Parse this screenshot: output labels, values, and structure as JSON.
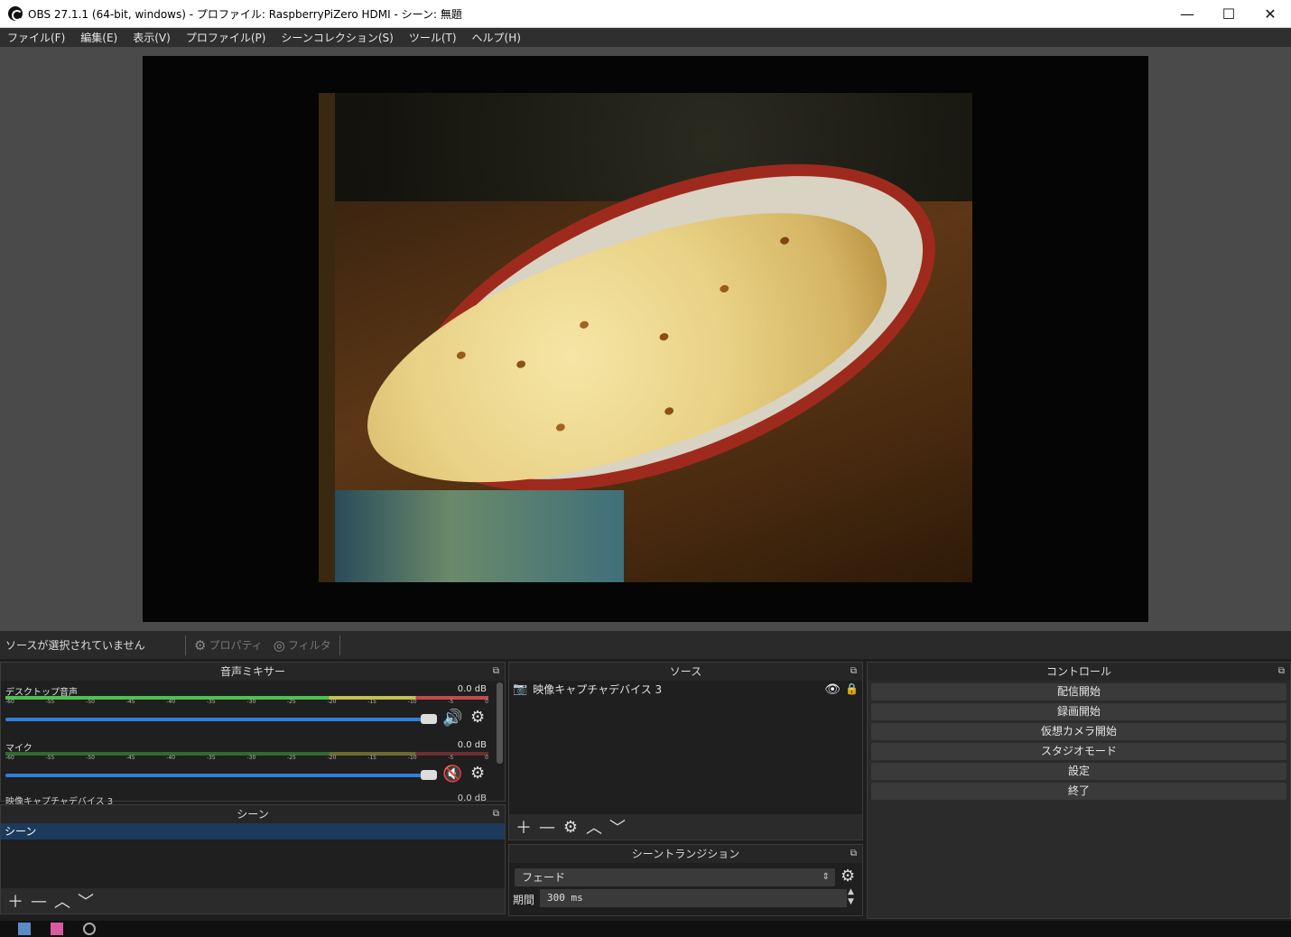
{
  "window": {
    "title": "OBS 27.1.1 (64-bit, windows) - プロファイル: RaspberryPiZero HDMI - シーン: 無題",
    "minimize": "—",
    "maximize": "☐",
    "close": "✕"
  },
  "menu": [
    "ファイル(F)",
    "編集(E)",
    "表示(V)",
    "プロファイル(P)",
    "シーンコレクション(S)",
    "ツール(T)",
    "ヘルプ(H)"
  ],
  "status": {
    "no_source": "ソースが選択されていません",
    "properties": "プロパティ",
    "filters": "フィルタ"
  },
  "mixer": {
    "title": "音声ミキサー",
    "ticks": [
      "-60",
      "-55",
      "-50",
      "-45",
      "-40",
      "-35",
      "-30",
      "-25",
      "-20",
      "-15",
      "-10",
      "-5",
      "0"
    ],
    "channels": [
      {
        "name": "デスクトップ音声",
        "db": "0.0 dB",
        "volume": 1.0,
        "muted": false
      },
      {
        "name": "マイク",
        "db": "0.0 dB",
        "volume": 1.0,
        "muted": true
      },
      {
        "name": "映像キャプチャデバイス 3",
        "db": "0.0 dB"
      }
    ]
  },
  "scenes": {
    "title": "シーン",
    "items": [
      "シーン"
    ]
  },
  "sources": {
    "title": "ソース",
    "items": [
      "映像キャプチャデバイス 3"
    ]
  },
  "transitions": {
    "title": "シーントランジション",
    "selected": "フェード",
    "duration_label": "期間",
    "duration": "300 ms"
  },
  "controls": {
    "title": "コントロール",
    "buttons": [
      "配信開始",
      "録画開始",
      "仮想カメラ開始",
      "スタジオモード",
      "設定",
      "終了"
    ]
  },
  "icons": {
    "add": "plus-icon",
    "remove": "minus-icon",
    "settings": "gear-icon",
    "up": "chevron-up-icon",
    "down": "chevron-down-icon"
  }
}
